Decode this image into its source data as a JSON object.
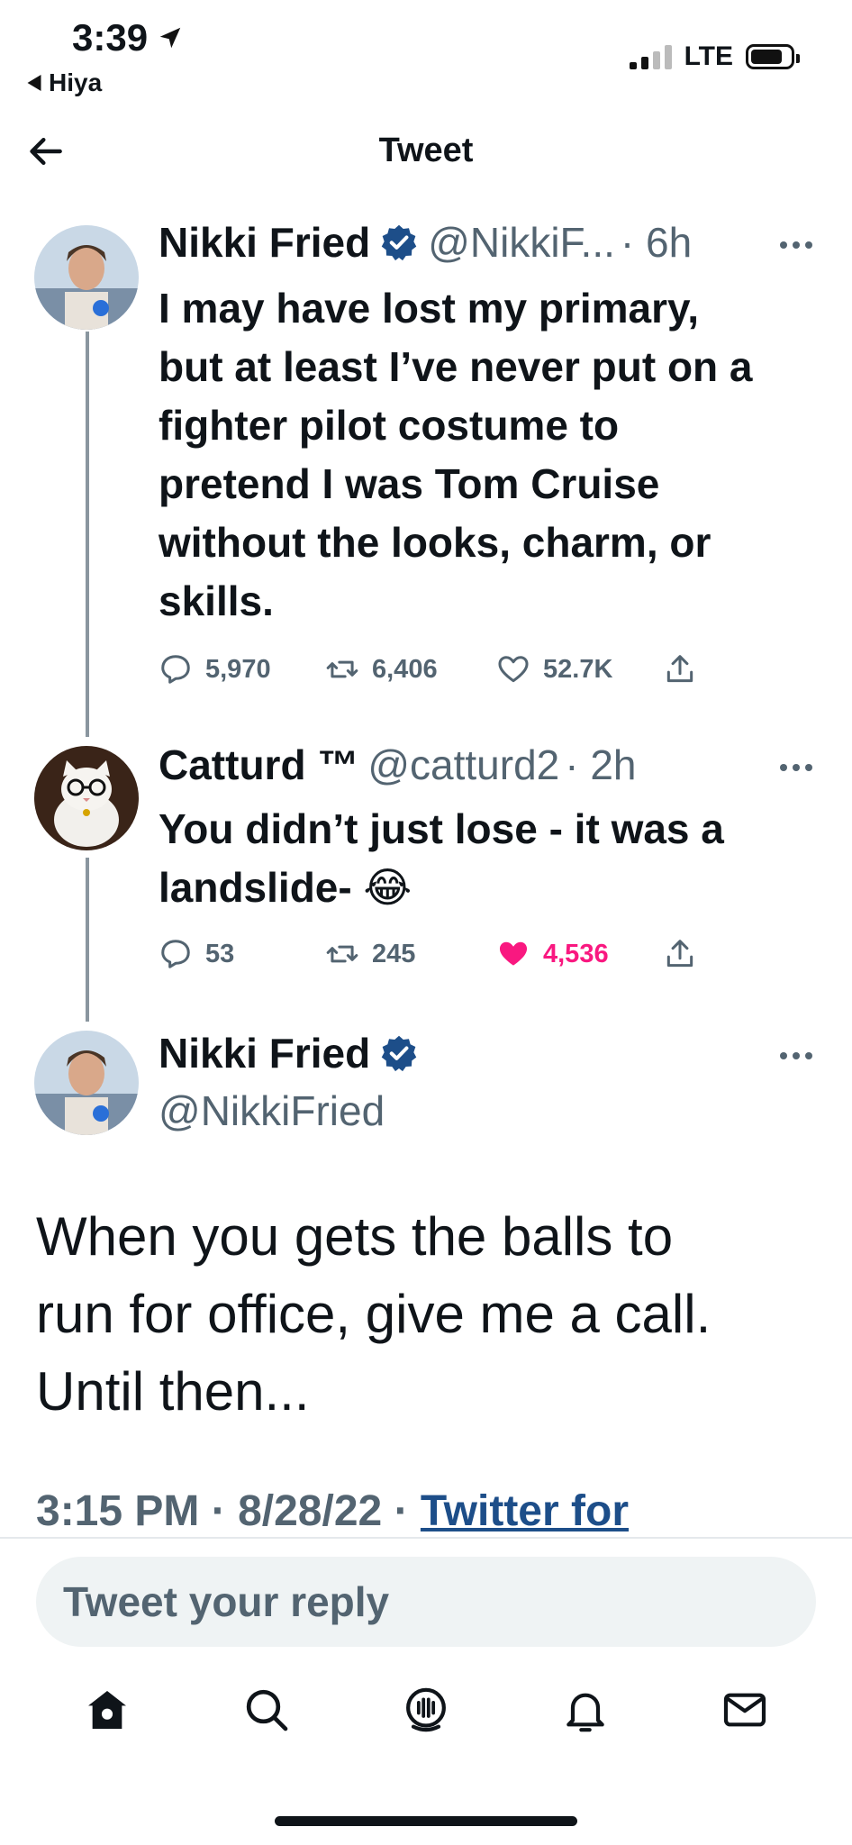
{
  "status_bar": {
    "time": "3:39",
    "back_app": "Hiya",
    "network": "LTE"
  },
  "header": {
    "title": "Tweet"
  },
  "tweets": [
    {
      "name": "Nikki Fried",
      "verified": true,
      "handle": "@NikkiF...",
      "time": "· 6h",
      "lines": [
        "I may have lost my primary,",
        "but at least I’ve never put on a",
        "fighter pilot costume to",
        "pretend I was Tom Cruise",
        "without the looks, charm, or",
        "skills."
      ],
      "replies": "5,970",
      "retweets": "6,406",
      "likes": "52.7K",
      "liked": false
    },
    {
      "name": "Catturd ™",
      "verified": false,
      "handle": "@catturd2",
      "time": "· 2h",
      "lines": [
        "You didn’t just lose -  it was a",
        "landslide- 😂"
      ],
      "replies": "53",
      "retweets": "245",
      "likes": "4,536",
      "liked": true
    }
  ],
  "main_tweet": {
    "name": "Nikki Fried",
    "handle": "@NikkiFried",
    "lines": [
      "When you gets the balls to",
      "run for office, give me a call.",
      "Until then..."
    ],
    "time": "3:15 PM",
    "date": "8/28/22",
    "source": "Twitter for"
  },
  "reply": {
    "placeholder": "Tweet your reply"
  },
  "tabs": [
    "home-icon",
    "search-icon",
    "spaces-icon",
    "notifications-icon",
    "messages-icon"
  ],
  "colors": {
    "verified": "#1d4e89",
    "like_active": "#f91880",
    "link": "#1d4e89",
    "muted": "#536471"
  }
}
